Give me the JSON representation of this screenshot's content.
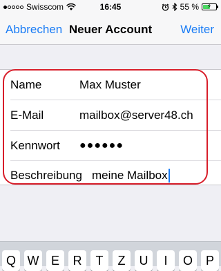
{
  "status_bar": {
    "carrier": "Swisscom",
    "time": "16:45",
    "battery_percent": "55 %",
    "battery_level": 0.55,
    "signal_bars_filled": 1,
    "signal_bars_total": 5,
    "icons": [
      "signal-icon",
      "wifi-icon",
      "alarm-icon",
      "bluetooth-icon",
      "battery-icon"
    ]
  },
  "nav": {
    "cancel_label": "Abbrechen",
    "title": "Neuer Account",
    "next_label": "Weiter"
  },
  "form": {
    "rows": [
      {
        "label": "Name",
        "value": "Max Muster"
      },
      {
        "label": "E-Mail",
        "value": "mailbox@server48.ch"
      },
      {
        "label": "Kennwort",
        "value": "●●●●●●"
      },
      {
        "label": "Beschreibung",
        "value": "meine Mailbox"
      }
    ]
  },
  "colors": {
    "accent": "#1a7cf5",
    "highlight": "#d81e2a",
    "battery": "#4cd964"
  },
  "keyboard": {
    "keys": [
      "Q",
      "W",
      "E",
      "R",
      "T",
      "Z",
      "U",
      "I",
      "O",
      "P"
    ]
  }
}
